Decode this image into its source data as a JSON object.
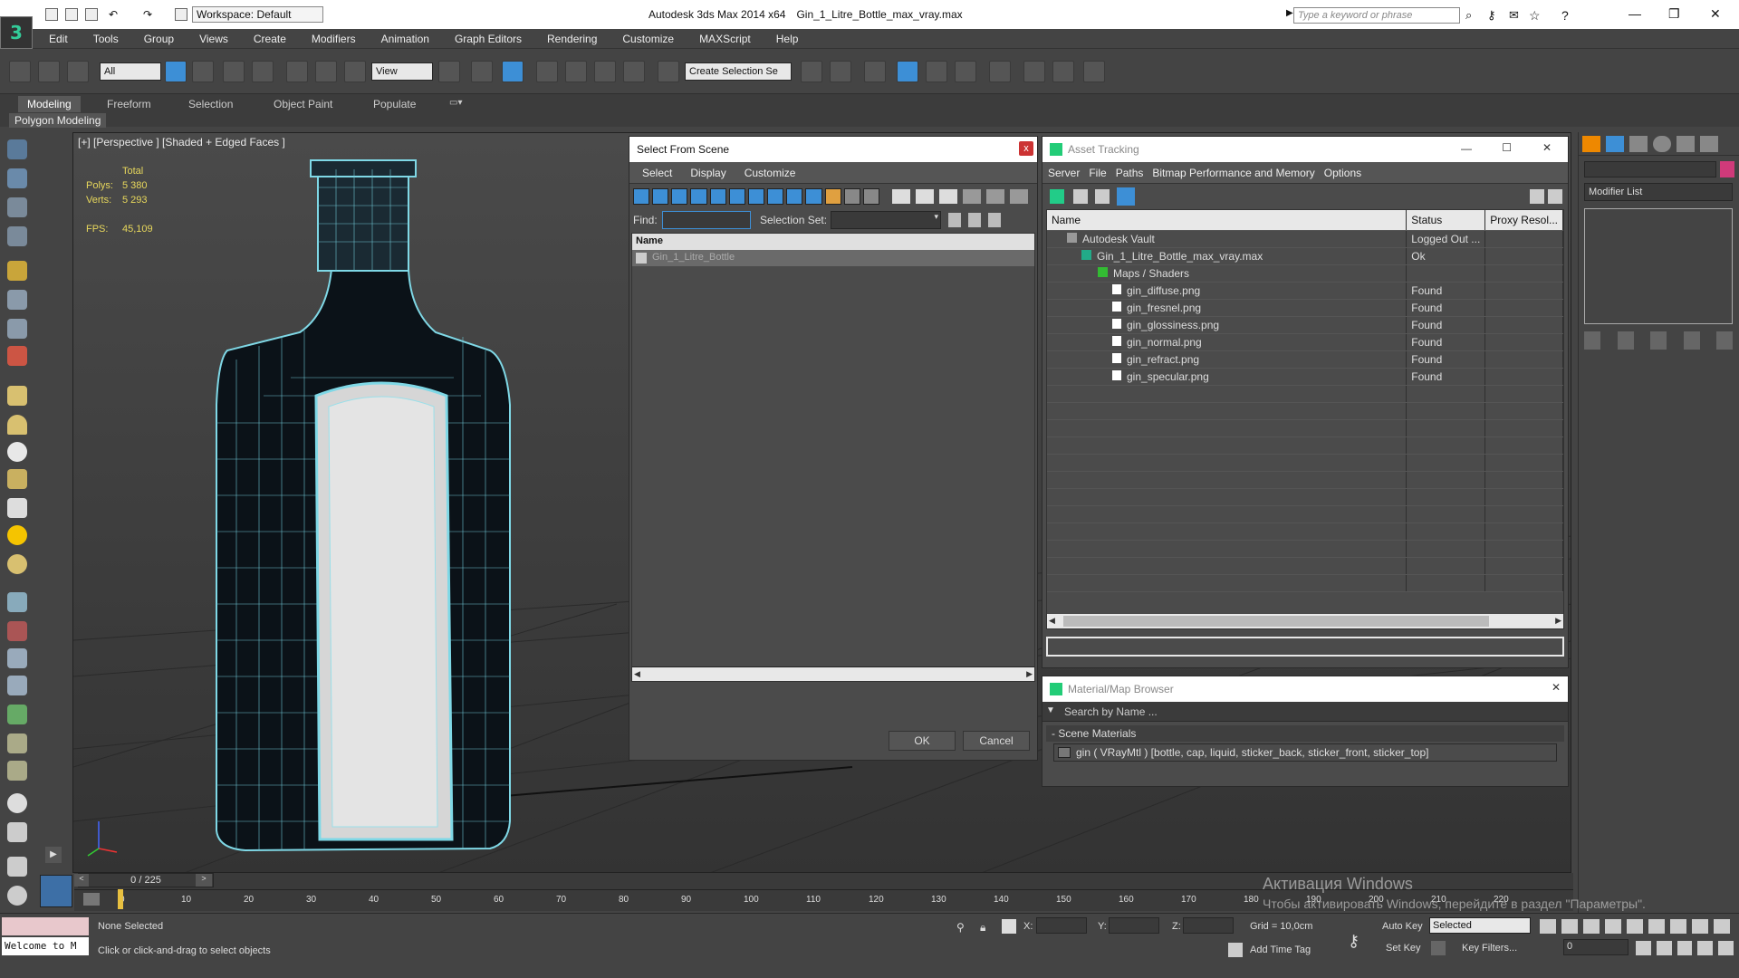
{
  "app": {
    "title": "Autodesk 3ds Max  2014 x64",
    "file": "Gin_1_Litre_Bottle_max_vray.max",
    "workspace": "Workspace: Default",
    "search_placeholder": "Type a keyword or phrase"
  },
  "menu": [
    "Edit",
    "Tools",
    "Group",
    "Views",
    "Create",
    "Modifiers",
    "Animation",
    "Graph Editors",
    "Rendering",
    "Customize",
    "MAXScript",
    "Help"
  ],
  "toolbar": {
    "filter": "All",
    "ref_coord": "View",
    "selection_set": "Create Selection Se"
  },
  "ribbon": {
    "tabs": [
      "Modeling",
      "Freeform",
      "Selection",
      "Object Paint",
      "Populate"
    ],
    "panel": "Polygon Modeling"
  },
  "viewport": {
    "label": "[+] [Perspective ] [Shaded + Edged Faces ]",
    "stats_header": "Total",
    "polys_label": "Polys:",
    "polys": "5 380",
    "verts_label": "Verts:",
    "verts": "5 293",
    "fps_label": "FPS:",
    "fps": "45,109"
  },
  "select_from_scene": {
    "title": "Select From Scene",
    "menu": [
      "Select",
      "Display",
      "Customize"
    ],
    "find_label": "Find:",
    "selset_label": "Selection Set:",
    "col_name": "Name",
    "items": [
      "Gin_1_Litre_Bottle"
    ],
    "ok": "OK",
    "cancel": "Cancel",
    "close": "x"
  },
  "asset_tracking": {
    "title": "Asset Tracking",
    "menu": [
      "Server",
      "File",
      "Paths",
      "Bitmap Performance and Memory",
      "Options"
    ],
    "columns": [
      "Name",
      "Status",
      "Proxy Resol..."
    ],
    "rows": [
      {
        "name": "Autodesk Vault",
        "status": "Logged Out ...",
        "level": 0
      },
      {
        "name": "Gin_1_Litre_Bottle_max_vray.max",
        "status": "Ok",
        "level": 1
      },
      {
        "name": "Maps / Shaders",
        "status": "",
        "level": 2
      },
      {
        "name": "gin_diffuse.png",
        "status": "Found",
        "level": 3
      },
      {
        "name": "gin_fresnel.png",
        "status": "Found",
        "level": 3
      },
      {
        "name": "gin_glossiness.png",
        "status": "Found",
        "level": 3
      },
      {
        "name": "gin_normal.png",
        "status": "Found",
        "level": 3
      },
      {
        "name": "gin_refract.png",
        "status": "Found",
        "level": 3
      },
      {
        "name": "gin_specular.png",
        "status": "Found",
        "level": 3
      }
    ]
  },
  "material_browser": {
    "title": "Material/Map Browser",
    "search": "Search by Name ...",
    "section": "- Scene Materials",
    "material": "gin  ( VRayMtl ) [bottle, cap, liquid, sticker_back, sticker_front, sticker_top]"
  },
  "modifier": {
    "list": "Modifier List"
  },
  "timeline": {
    "frame": "0 / 225",
    "ticks": [
      "0",
      "10",
      "20",
      "30",
      "40",
      "50",
      "60",
      "70",
      "80",
      "90",
      "100",
      "110",
      "120",
      "130",
      "140",
      "150",
      "160",
      "170",
      "180",
      "190",
      "200",
      "210",
      "220"
    ]
  },
  "status": {
    "maxscript": "Welcome to M",
    "selection": "None Selected",
    "prompt": "Click or click-and-drag to select objects",
    "x": "X:",
    "y": "Y:",
    "z": "Z:",
    "grid": "Grid = 10,0cm",
    "add_time_tag": "Add Time Tag",
    "auto_key": "Auto Key",
    "set_key": "Set Key",
    "selected": "Selected",
    "key_filters": "Key Filters...",
    "frame": "0"
  },
  "watermark": {
    "line1": "Активация Windows",
    "line2": "Чтобы активировать Windows, перейдите в раздел \"Параметры\"."
  }
}
